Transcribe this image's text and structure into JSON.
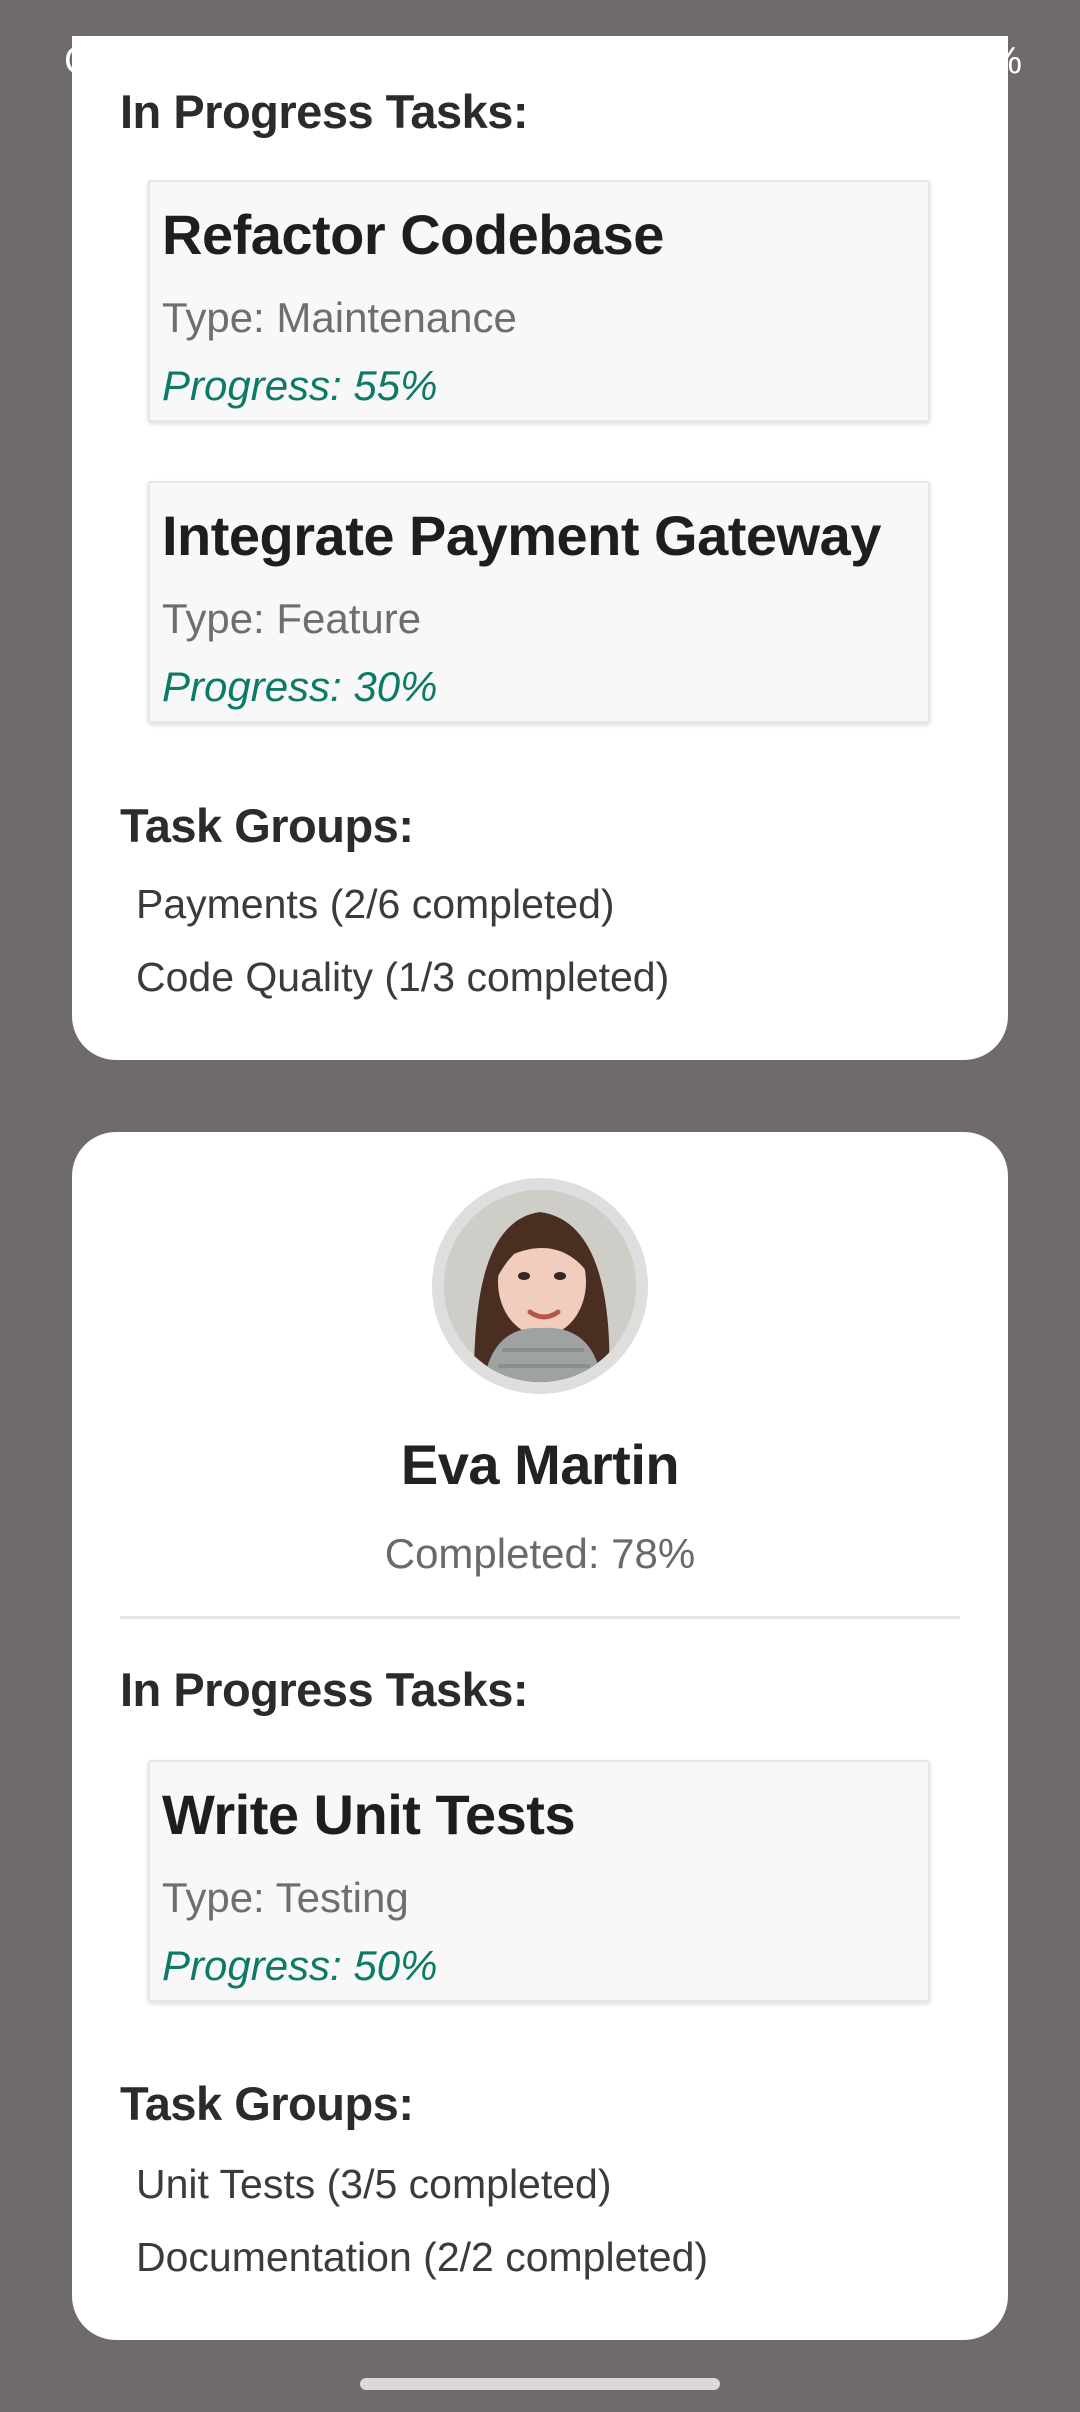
{
  "status_bar": {
    "time": "C",
    "battery": "%"
  },
  "cards": [
    {
      "in_progress_title": "In Progress Tasks:",
      "tasks": [
        {
          "title": "Refactor Codebase",
          "type": "Type: Maintenance",
          "progress": "Progress: 55%"
        },
        {
          "title": "Integrate Payment Gateway",
          "type": "Type: Feature",
          "progress": "Progress: 30%"
        }
      ],
      "groups_title": "Task Groups:",
      "groups": [
        "Payments (2/6 completed)",
        "Code Quality (1/3 completed)"
      ]
    },
    {
      "name": "Eva Martin",
      "completed": "Completed: 78%",
      "in_progress_title": "In Progress Tasks:",
      "tasks": [
        {
          "title": "Write Unit Tests",
          "type": "Type: Testing",
          "progress": "Progress: 50%"
        }
      ],
      "groups_title": "Task Groups:",
      "groups": [
        "Unit Tests (3/5 completed)",
        "Documentation (2/2 completed)"
      ]
    }
  ],
  "colors": {
    "backdrop": "#6f6a6d",
    "progress": "#0d7a68",
    "battery": "#1cc32a"
  }
}
